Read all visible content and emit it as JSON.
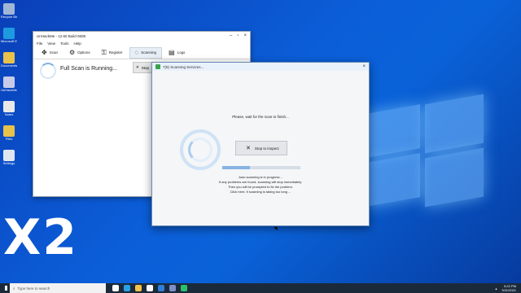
{
  "overlay": {
    "multiplier": "X2"
  },
  "desktop": {
    "icons": [
      {
        "label": "Recycle Bin",
        "icon": "recycle-bin-icon",
        "color": "#9fb6d6"
      },
      {
        "label": "Microsoft Edge",
        "icon": "edge-icon",
        "color": "#1e9be0"
      },
      {
        "label": "Documents",
        "icon": "folder-icon",
        "color": "#e8c24a"
      },
      {
        "label": "UnHackMe",
        "icon": "unhackme-icon",
        "color": "#c7cbe8"
      },
      {
        "label": "Notes",
        "icon": "notes-icon",
        "color": "#e9e9e9"
      },
      {
        "label": "Files",
        "icon": "folder-icon",
        "color": "#e8c24a"
      },
      {
        "label": "Settings",
        "icon": "app-icon",
        "color": "#dfe6f0"
      }
    ]
  },
  "main_window": {
    "title": "UnHackMe - 12.60 Build 0608",
    "menu": [
      "File",
      "View",
      "Tools",
      "Help"
    ],
    "toolbar": [
      {
        "label": "Scan",
        "icon": "crosshair-icon",
        "active": false
      },
      {
        "label": "Options",
        "icon": "gear-icon",
        "active": false
      },
      {
        "label": "Register",
        "icon": "key-icon",
        "active": false
      },
      {
        "label": "Scanning",
        "icon": "spinner-icon",
        "active": true
      },
      {
        "label": "Logs",
        "icon": "logs-icon",
        "active": false
      }
    ],
    "status": "Full Scan is Running...",
    "stop_label": "Stop"
  },
  "dialog": {
    "title": "7(8) Scanning Services...",
    "wait_message": "Please, wait for the scan to finish...",
    "stop_button": "Stop to inspect",
    "progress": 0.35,
    "info_lines": [
      "Auto scanning is in progress...",
      "If any problems are found, scanning will stop immediately.",
      "Then you will be prompted to fix the problem.",
      "Click here, if scanning is taking too long ..."
    ]
  },
  "taskbar": {
    "search_placeholder": "Type here to search",
    "apps": [
      {
        "icon": "task-view-icon",
        "color": "#ffffff"
      },
      {
        "icon": "edge-icon",
        "color": "#2aa0e6"
      },
      {
        "icon": "file-explorer-icon",
        "color": "#f0c44a"
      },
      {
        "icon": "store-icon",
        "color": "#ffffff"
      },
      {
        "icon": "mail-icon",
        "color": "#2f7fd6"
      },
      {
        "icon": "unhackme-icon",
        "color": "#7f8ec4"
      },
      {
        "icon": "app-icon",
        "color": "#2cbf6a"
      }
    ],
    "time": "5:22 PM",
    "date": "9/11/2021"
  }
}
